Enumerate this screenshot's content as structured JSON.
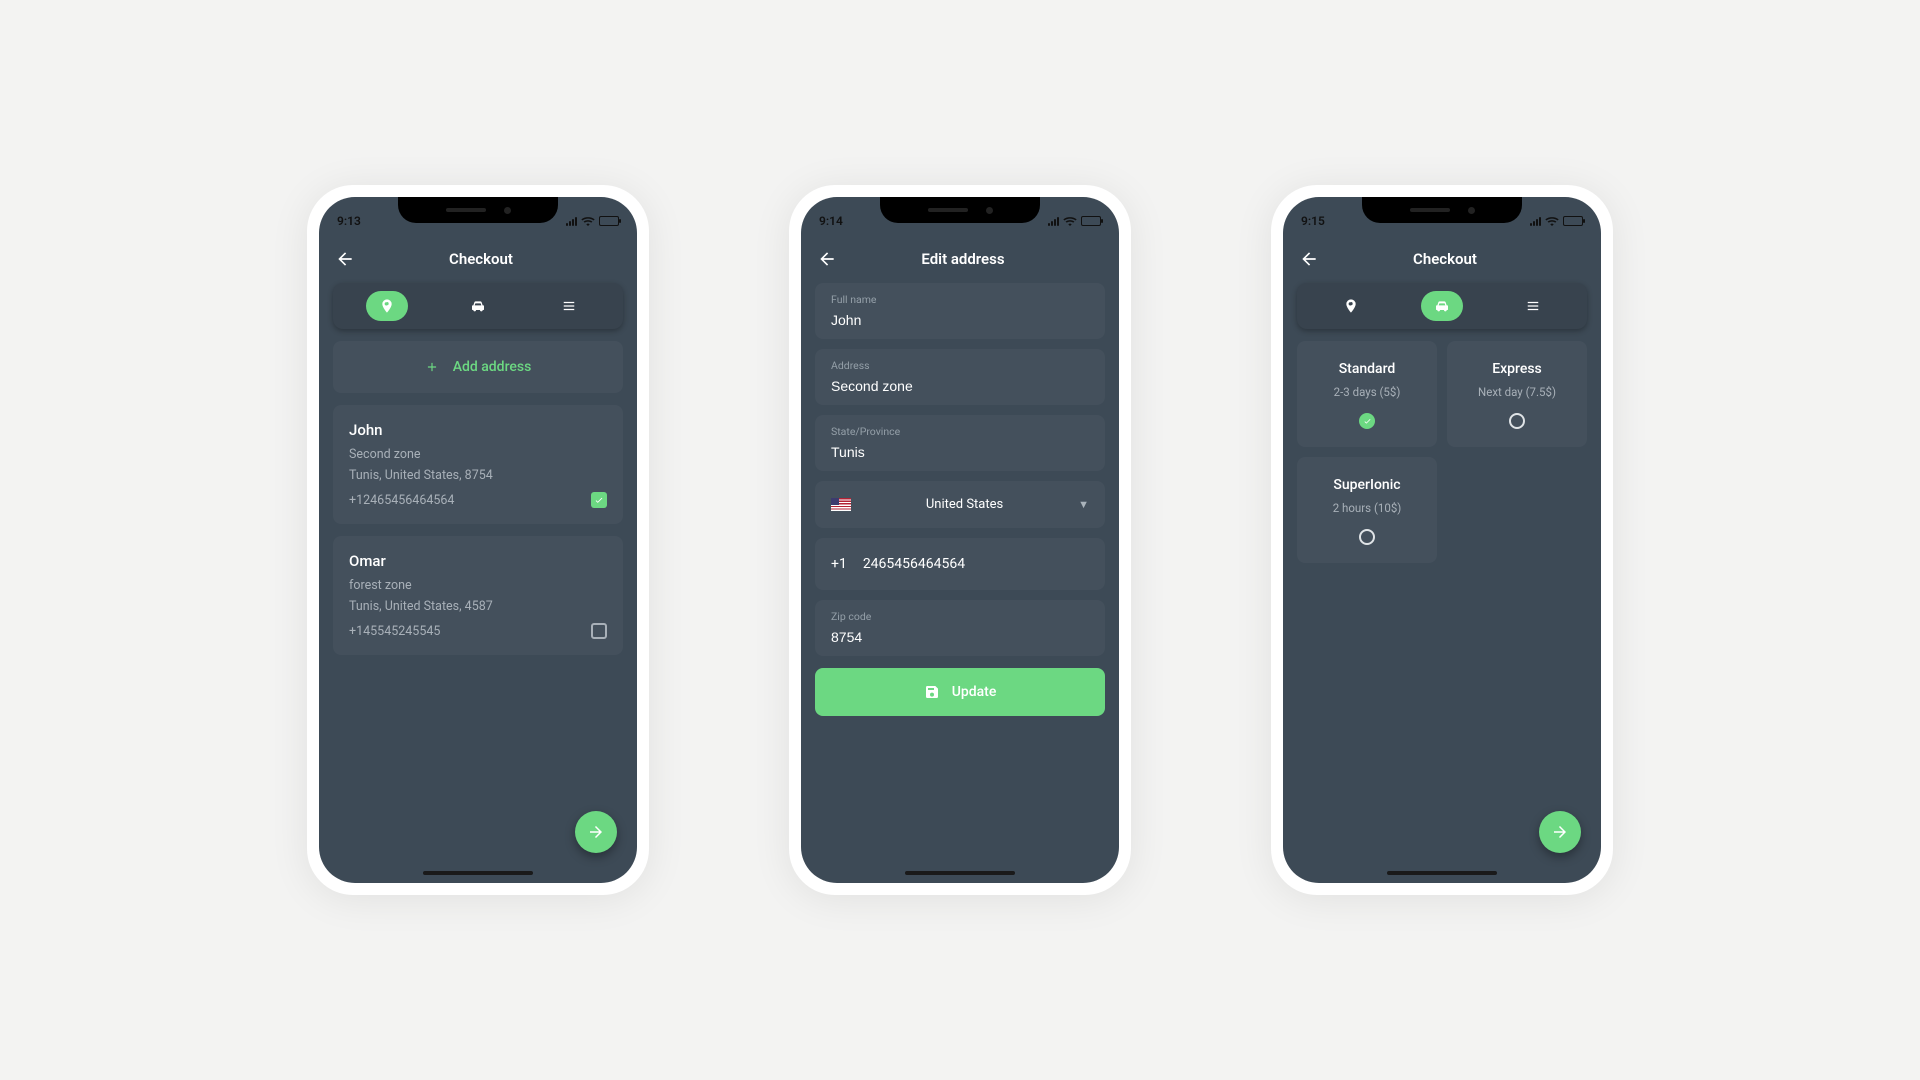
{
  "screen1": {
    "time": "9:13",
    "title": "Checkout",
    "add_address_label": "Add address",
    "addresses": [
      {
        "name": "John",
        "line1": "Second zone",
        "line2": "Tunis, United States, 8754",
        "phone": "+12465456464564",
        "selected": true
      },
      {
        "name": "Omar",
        "line1": "forest zone",
        "line2": "Tunis, United States, 4587",
        "phone": "+145545245545",
        "selected": false
      }
    ]
  },
  "screen2": {
    "time": "9:14",
    "title": "Edit address",
    "fields": {
      "fullname_label": "Full name",
      "fullname_value": "John",
      "address_label": "Address",
      "address_value": "Second zone",
      "state_label": "State/Province",
      "state_value": "Tunis",
      "country_value": "United States",
      "dial_code": "+1",
      "phone_value": "2465456464564",
      "zip_label": "Zip code",
      "zip_value": "8754"
    },
    "update_label": "Update"
  },
  "screen3": {
    "time": "9:15",
    "title": "Checkout",
    "options": [
      {
        "name": "Standard",
        "info": "2-3 days (5$)",
        "selected": true
      },
      {
        "name": "Express",
        "info": "Next day (7.5$)",
        "selected": false
      },
      {
        "name": "SuperIonic",
        "info": "2 hours (10$)",
        "selected": false
      }
    ]
  }
}
